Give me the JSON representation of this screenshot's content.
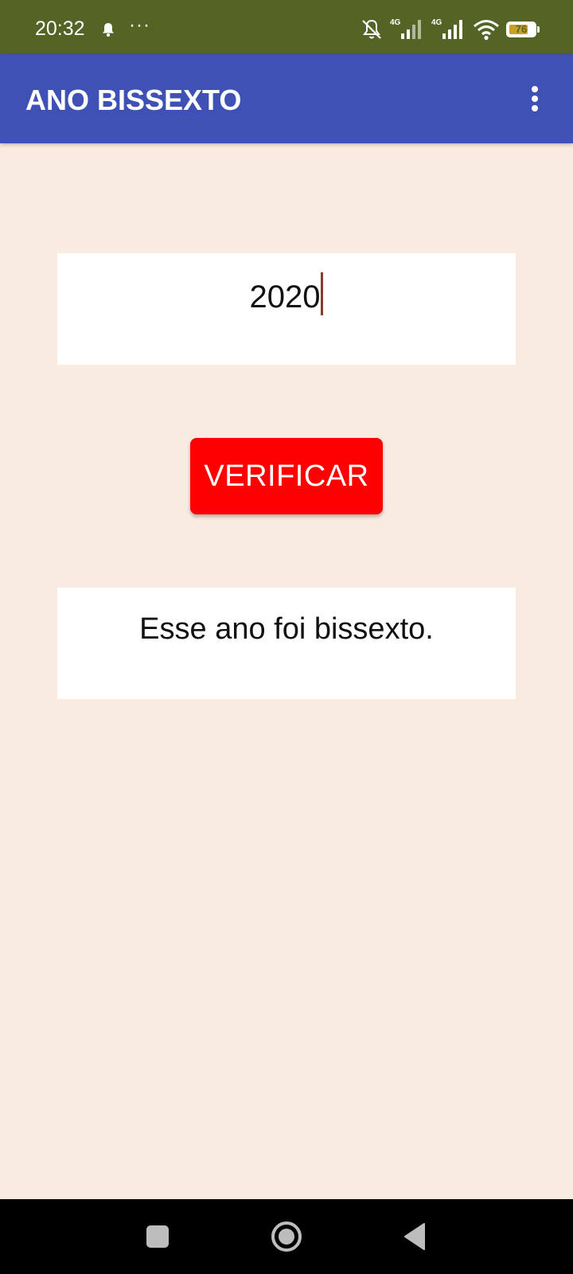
{
  "status_bar": {
    "time": "20:32",
    "more_indicator": "···",
    "network_1": "4G",
    "network_2": "4G",
    "battery_level": "76",
    "battery_fraction": 0.76,
    "icons": [
      "bell-icon",
      "mute-icon",
      "signal-icon",
      "signal-icon",
      "wifi-icon",
      "battery-icon"
    ]
  },
  "app_bar": {
    "title": "ANO BISSEXTO",
    "menu_icon": "overflow-menu-icon"
  },
  "year_input": {
    "value": "2020"
  },
  "verify_button": {
    "label": "VERIFICAR"
  },
  "result": {
    "text": "Esse ano foi bissexto."
  },
  "nav_bar": {
    "icons": [
      "recents-icon",
      "home-icon",
      "back-icon"
    ]
  },
  "colors": {
    "status_bar": "#536425",
    "app_bar": "#3f51b5",
    "background": "#faebe1",
    "button": "#ff0000",
    "caret": "#8b3a2b"
  }
}
